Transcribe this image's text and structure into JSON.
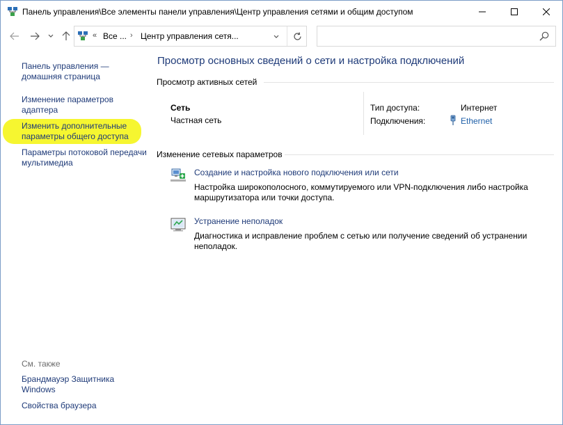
{
  "window": {
    "title": "Панель управления\\Все элементы панели управления\\Центр управления сетями и общим доступом"
  },
  "address": {
    "chevrons": "«",
    "segment1": "Все ...",
    "separator": "›",
    "segment2": "Центр управления сетя...",
    "search_placeholder": ""
  },
  "left_pane": {
    "home_link": "Панель управления — домашняя страница",
    "adapter_link": "Изменение параметров адаптера",
    "sharing_link": "Изменить дополнительные параметры общего доступа",
    "media_link": "Параметры потоковой передачи мультимедиа",
    "see_also": "См. также",
    "firewall_link": "Брандмауэр Защитника Windows",
    "browser_link": "Свойства браузера"
  },
  "main": {
    "title": "Просмотр основных сведений о сети и настройка подключений",
    "active_networks": "Просмотр активных сетей",
    "network_name": "Сеть",
    "network_profile": "Частная сеть",
    "access_type_label": "Тип доступа:",
    "access_type_value": "Интернет",
    "connections_label": "Подключения:",
    "connection_link": "Ethernet",
    "change_settings": "Изменение сетевых параметров",
    "tasks": [
      {
        "link": "Создание и настройка нового подключения или сети",
        "desc": "Настройка широкополосного, коммутируемого или VPN-подключения либо настройка маршрутизатора или точки доступа.",
        "icon": "new-connection-icon"
      },
      {
        "link": "Устранение неполадок",
        "desc": "Диагностика и исправление проблем с сетью или получение сведений об устранении неполадок.",
        "icon": "troubleshoot-icon"
      }
    ]
  },
  "colors": {
    "link": "#1e3a78",
    "accent_link": "#1e5fa8",
    "highlight": "#f4f40c"
  }
}
